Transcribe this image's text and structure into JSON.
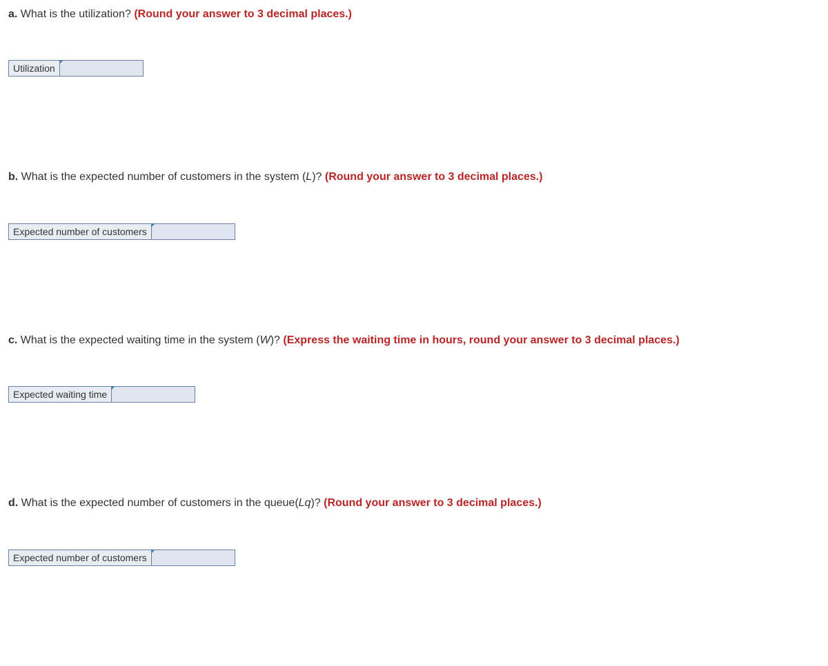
{
  "questions": [
    {
      "label": "a.",
      "text": " What is the utilization? ",
      "hint": "(Round your answer to 3 decimal places.)",
      "answer_label": "Utilization",
      "answer_value": ""
    },
    {
      "label": "b.",
      "text_pre": " What is the expected number of customers in the system (",
      "italic": "L",
      "text_post": ")? ",
      "hint": "(Round your answer to 3 decimal places.)",
      "answer_label": "Expected number of customers",
      "answer_value": ""
    },
    {
      "label": "c.",
      "text_pre": " What is the expected waiting time in the system (",
      "italic": "W",
      "text_post": ")? ",
      "hint": "(Express the waiting time in hours, round your answer to 3 decimal places.)",
      "answer_label": "Expected waiting time",
      "answer_value": ""
    },
    {
      "label": "d.",
      "text_pre": " What is the expected number of customers in the queue(",
      "italic": "Lq",
      "text_post": ")? ",
      "hint": "(Round your answer to 3 decimal places.)",
      "answer_label": "Expected number of customers",
      "answer_value": ""
    }
  ]
}
